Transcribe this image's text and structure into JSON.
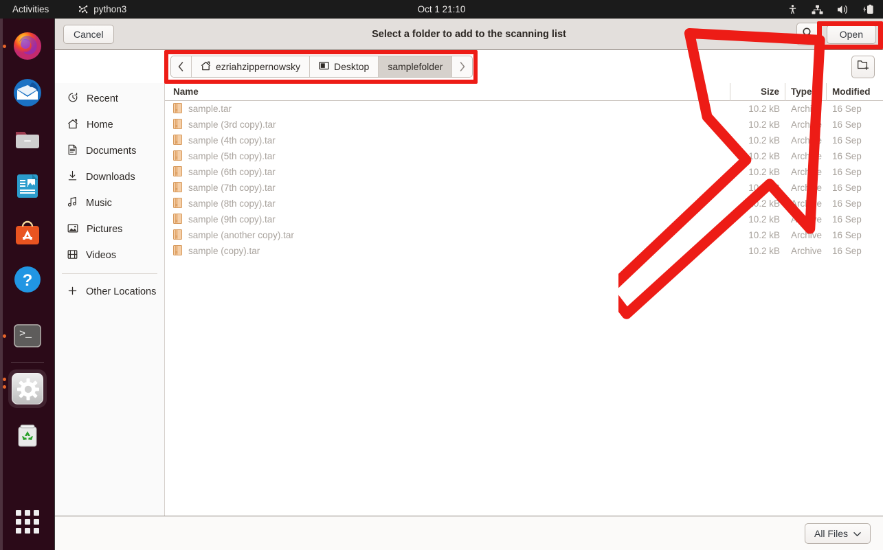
{
  "topbar": {
    "activities": "Activities",
    "app_name": "python3",
    "app_icon": "python-icon",
    "clock": "Oct 1  21:10",
    "tray": [
      {
        "name": "accessibility-icon"
      },
      {
        "name": "network-icon"
      },
      {
        "name": "volume-icon"
      },
      {
        "name": "battery-icon"
      }
    ]
  },
  "dock": {
    "items": [
      {
        "name": "firefox",
        "running": true,
        "focused": false
      },
      {
        "name": "thunderbird",
        "running": false,
        "focused": false
      },
      {
        "name": "files",
        "running": false,
        "focused": false
      },
      {
        "name": "libreoffice-writer",
        "running": false,
        "focused": false
      },
      {
        "name": "ubuntu-software",
        "running": false,
        "focused": false
      },
      {
        "name": "help",
        "running": false,
        "focused": false
      },
      {
        "name": "terminal",
        "running": true,
        "focused": false
      },
      {
        "name": "settings",
        "running": true,
        "focused": true
      },
      {
        "name": "trash",
        "running": false,
        "focused": false
      }
    ],
    "show_apps_label": "Show Applications"
  },
  "dialog": {
    "title": "Select a folder to add to the scanning list",
    "cancel_label": "Cancel",
    "open_label": "Open",
    "search_icon": "search-icon",
    "new_folder_icon": "new-folder-icon",
    "filter_label": "All Files",
    "filter_chevron": "chevron-down-icon"
  },
  "pathbar": {
    "back_icon": "chevron-left-icon",
    "forward_icon": "chevron-right-icon",
    "crumbs": [
      {
        "label": "ezriahzippernowsky",
        "icon": "home-icon",
        "active": false
      },
      {
        "label": "Desktop",
        "icon": "desktop-icon",
        "active": false
      },
      {
        "label": "samplefolder",
        "icon": "",
        "active": true
      }
    ]
  },
  "sidebar": {
    "items": [
      {
        "label": "Recent",
        "icon": "clock-icon"
      },
      {
        "label": "Home",
        "icon": "home-icon"
      },
      {
        "label": "Documents",
        "icon": "document-icon"
      },
      {
        "label": "Downloads",
        "icon": "download-icon"
      },
      {
        "label": "Music",
        "icon": "music-note-icon"
      },
      {
        "label": "Pictures",
        "icon": "image-icon"
      },
      {
        "label": "Videos",
        "icon": "film-icon"
      }
    ],
    "other_locations": {
      "label": "Other Locations",
      "icon": "plus-icon"
    }
  },
  "filelist": {
    "columns": [
      "Name",
      "Size",
      "Type",
      "Modified"
    ],
    "rows": [
      {
        "name": "sample.tar",
        "size": "10.2 kB",
        "type": "Archive",
        "modified": "16 Sep"
      },
      {
        "name": "sample (3rd copy).tar",
        "size": "10.2 kB",
        "type": "Archive",
        "modified": "16 Sep"
      },
      {
        "name": "sample (4th copy).tar",
        "size": "10.2 kB",
        "type": "Archive",
        "modified": "16 Sep"
      },
      {
        "name": "sample (5th copy).tar",
        "size": "10.2 kB",
        "type": "Archive",
        "modified": "16 Sep"
      },
      {
        "name": "sample (6th copy).tar",
        "size": "10.2 kB",
        "type": "Archive",
        "modified": "16 Sep"
      },
      {
        "name": "sample (7th copy).tar",
        "size": "10.2 kB",
        "type": "Archive",
        "modified": "16 Sep"
      },
      {
        "name": "sample (8th copy).tar",
        "size": "10.2 kB",
        "type": "Archive",
        "modified": "16 Sep"
      },
      {
        "name": "sample (9th copy).tar",
        "size": "10.2 kB",
        "type": "Archive",
        "modified": "16 Sep"
      },
      {
        "name": "sample (another copy).tar",
        "size": "10.2 kB",
        "type": "Archive",
        "modified": "16 Sep"
      },
      {
        "name": "sample (copy).tar",
        "size": "10.2 kB",
        "type": "Archive",
        "modified": "16 Sep"
      }
    ]
  },
  "annotations": {
    "color": "#ed1c16",
    "highlight_pathbar": true,
    "highlight_open_button": true,
    "arrow_points_to": "open-button"
  }
}
